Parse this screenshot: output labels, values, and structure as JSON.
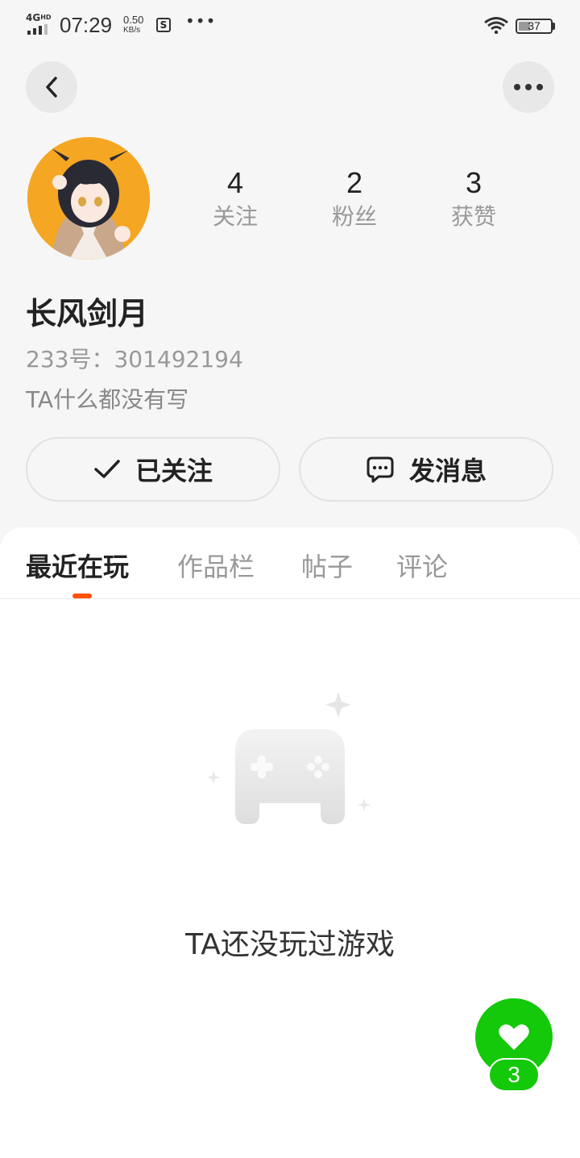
{
  "status_bar": {
    "network": "4G",
    "network_sub": "HD",
    "time": "07:29",
    "speed_value": "0.50",
    "speed_unit": "KB/s",
    "dots": "•••",
    "battery": "37"
  },
  "profile": {
    "stats": [
      {
        "value": "4",
        "label": "关注"
      },
      {
        "value": "2",
        "label": "粉丝"
      },
      {
        "value": "3",
        "label": "获赞"
      }
    ],
    "nickname": "长风剑月",
    "uid": "233号：301492194",
    "bio": "TA什么都没有写"
  },
  "actions": {
    "follow_label": "已关注",
    "message_label": "发消息"
  },
  "tabs": [
    {
      "label": "最近在玩",
      "active": true
    },
    {
      "label": "作品栏",
      "active": false
    },
    {
      "label": "帖子",
      "active": false
    },
    {
      "label": "评论",
      "active": false
    }
  ],
  "empty_state": {
    "text": "TA还没玩过游戏"
  },
  "like": {
    "count": "3",
    "color": "#14c80a"
  },
  "colors": {
    "accent": "#ff5000",
    "background": "#f6f6f6"
  },
  "icons": [
    "back-icon",
    "more-icon",
    "check-icon",
    "message-bubble-icon",
    "gamepad-icon",
    "heart-icon",
    "wifi-icon",
    "battery-icon"
  ]
}
